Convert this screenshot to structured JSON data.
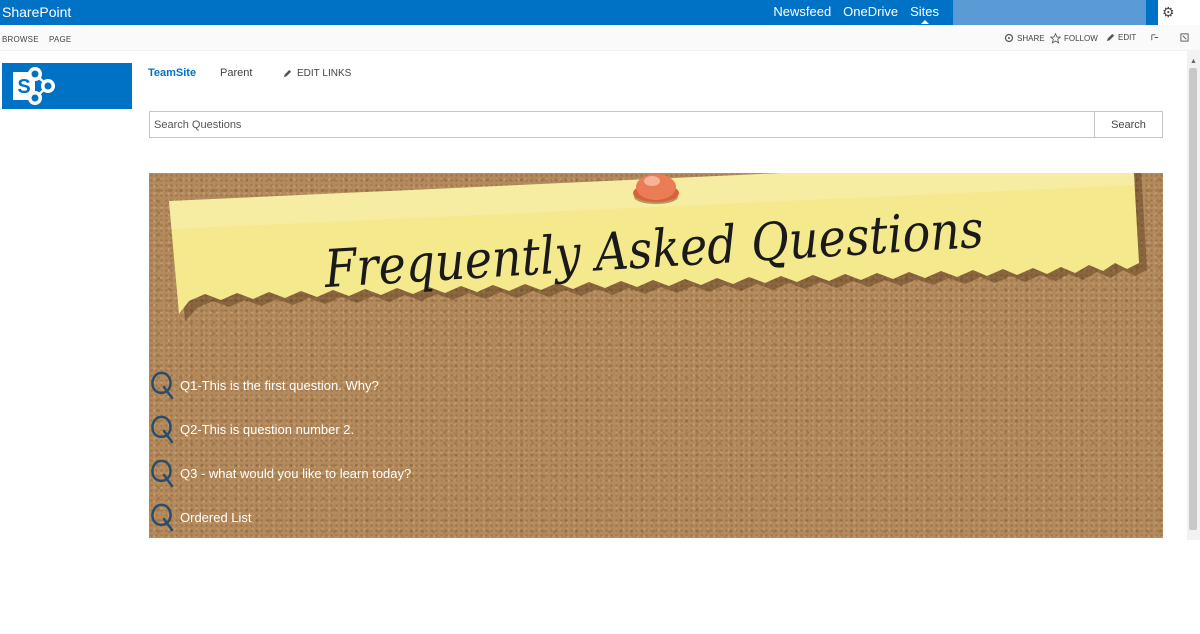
{
  "suite_bar": {
    "brand": "SharePoint",
    "links": [
      "Newsfeed",
      "OneDrive",
      "Sites"
    ],
    "active_link": "Sites"
  },
  "ribbon": {
    "tabs": [
      "BROWSE",
      "PAGE"
    ],
    "actions": {
      "share": "SHARE",
      "follow": "FOLLOW",
      "edit": "EDIT"
    }
  },
  "site_logo_letter": "S",
  "top_nav": {
    "current_site": "TeamSite",
    "parent": "Parent",
    "edit_links": "EDIT LINKS"
  },
  "search": {
    "placeholder": "Search Questions",
    "button": "Search"
  },
  "banner": {
    "title": "Frequently Asked Questions"
  },
  "faq_items": [
    "Q1-This is the first question. Why?",
    "Q2-This is question number 2.",
    "Q3 - what would you like to learn today?",
    "Ordered List"
  ],
  "colors": {
    "suite_bar": "#0072c6",
    "corkboard": "#b48a5c",
    "sticky_note": "#f5e98e",
    "pushpin": "#ea7d55",
    "q_icon": "#2a4d6e"
  }
}
